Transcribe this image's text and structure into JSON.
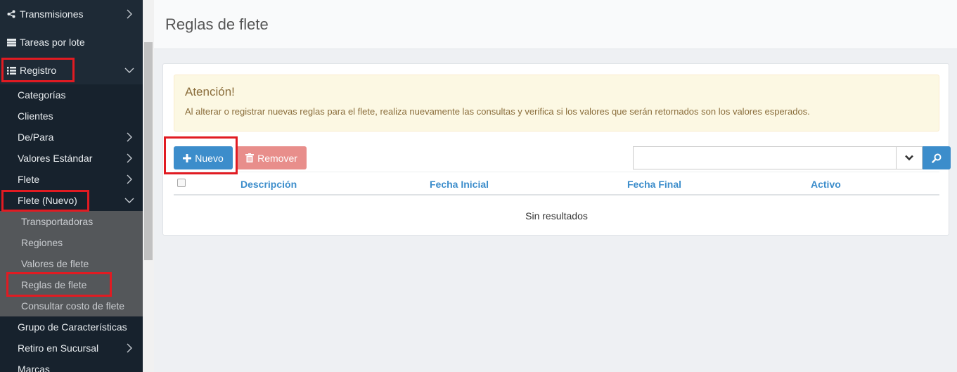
{
  "sidebar": {
    "top_items": [
      {
        "label": "Transmisiones",
        "icon": "share-icon"
      },
      {
        "label": "Tareas por lote",
        "icon": "batch-icon"
      },
      {
        "label": "Registro",
        "icon": "list-icon"
      }
    ],
    "registro_items": [
      {
        "label": "Categorías",
        "has_arrow": false
      },
      {
        "label": "Clientes",
        "has_arrow": false
      },
      {
        "label": "De/Para",
        "has_arrow": true
      },
      {
        "label": "Valores Estándar",
        "has_arrow": true
      },
      {
        "label": "Flete",
        "has_arrow": true
      },
      {
        "label": "Flete (Nuevo)",
        "has_arrow": true
      }
    ],
    "flete_nuevo_items": [
      {
        "label": "Transportadoras"
      },
      {
        "label": "Regiones"
      },
      {
        "label": "Valores de flete"
      },
      {
        "label": "Reglas de flete"
      },
      {
        "label": "Consultar costo de flete"
      }
    ],
    "bottom_items": [
      {
        "label": "Grupo de Características",
        "has_arrow": false
      },
      {
        "label": "Retiro en Sucursal",
        "has_arrow": true
      },
      {
        "label": "Marcas",
        "has_arrow": false
      }
    ]
  },
  "header": {
    "title": "Reglas de flete"
  },
  "alert": {
    "title": "Atención!",
    "text": "Al alterar o registrar nuevas reglas para el flete, realiza nuevamente las consultas y verifica si los valores que serán retornados son los valores esperados."
  },
  "toolbar": {
    "new_label": "Nuevo",
    "remove_label": "Remover"
  },
  "search": {
    "placeholder": ""
  },
  "table": {
    "columns": [
      "Descripción",
      "Fecha Inicial",
      "Fecha Final",
      "Activo"
    ],
    "empty_text": "Sin resultados"
  },
  "colors": {
    "primary": "#3c8dcb",
    "danger_disabled": "#e88e8b",
    "highlight": "#e11b22",
    "sidebar": "#1e2a36"
  }
}
